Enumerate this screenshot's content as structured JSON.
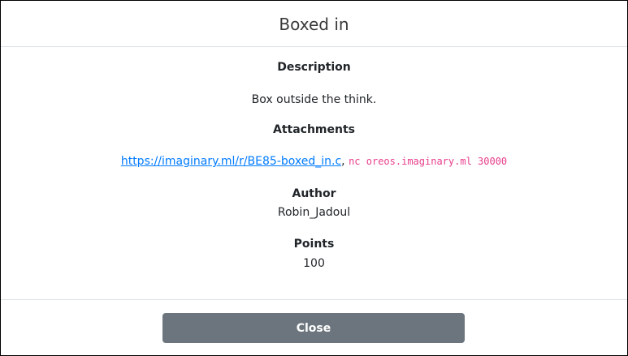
{
  "modal": {
    "title": "Boxed in",
    "description_label": "Description",
    "description_text": "Box outside the think.",
    "attachments_label": "Attachments",
    "attachment_link": "https://imaginary.ml/r/BE85-boxed_in.c",
    "attachment_separator": ",",
    "attachment_command": "nc oreos.imaginary.ml 30000",
    "author_label": "Author",
    "author_value": "Robin_Jadoul",
    "points_label": "Points",
    "points_value": "100",
    "close_label": "Close"
  },
  "colors": {
    "link": "#007bff",
    "code": "#e83e8c",
    "close_button": "#6c757d"
  }
}
